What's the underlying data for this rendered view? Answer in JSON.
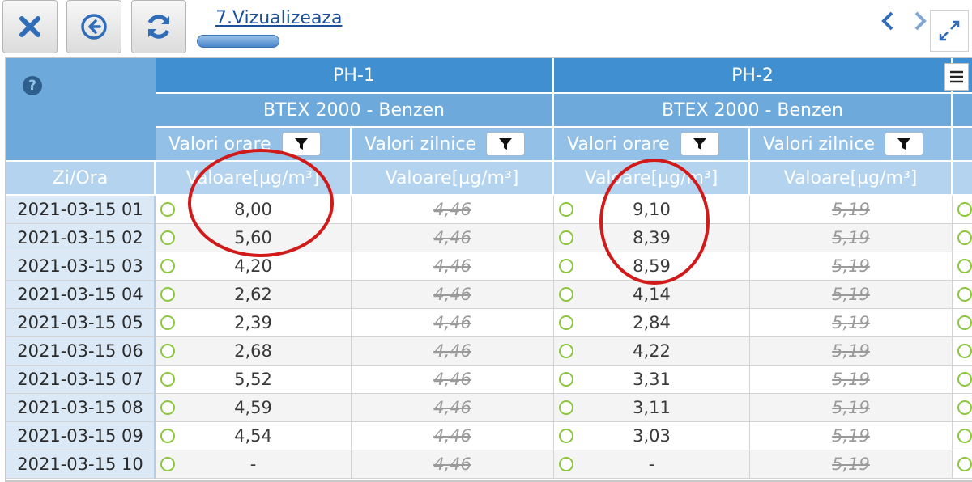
{
  "toolbar": {
    "tab_label": "7.Vizualizeaza",
    "icons": {
      "close": "close-icon",
      "back": "back-circle-icon",
      "refresh": "refresh-icon",
      "prev": "chevron-left-icon",
      "next": "chevron-right-icon",
      "expand": "expand-icon"
    }
  },
  "grid": {
    "corner_header": "Zi/Ora",
    "stations": [
      {
        "name": "PH-1",
        "pollutant": "BTEX 2000 - Benzen"
      },
      {
        "name": "PH-2",
        "pollutant": "BTEX 2000 - Benzen"
      }
    ],
    "subheaders": {
      "hourly": "Valori orare",
      "daily": "Valori zilnice"
    },
    "unit_header": "Valoare[µg/m³]",
    "rows": [
      {
        "date": "2021-03-15 01",
        "ph1_hourly": "8,00",
        "ph1_daily": "4,46",
        "ph2_hourly": "9,10",
        "ph2_daily": "5,19"
      },
      {
        "date": "2021-03-15 02",
        "ph1_hourly": "5,60",
        "ph1_daily": "4,46",
        "ph2_hourly": "8,39",
        "ph2_daily": "5,19"
      },
      {
        "date": "2021-03-15 03",
        "ph1_hourly": "4,20",
        "ph1_daily": "4,46",
        "ph2_hourly": "8,59",
        "ph2_daily": "5,19"
      },
      {
        "date": "2021-03-15 04",
        "ph1_hourly": "2,62",
        "ph1_daily": "4,46",
        "ph2_hourly": "4,14",
        "ph2_daily": "5,19"
      },
      {
        "date": "2021-03-15 05",
        "ph1_hourly": "2,39",
        "ph1_daily": "4,46",
        "ph2_hourly": "2,84",
        "ph2_daily": "5,19"
      },
      {
        "date": "2021-03-15 06",
        "ph1_hourly": "2,68",
        "ph1_daily": "4,46",
        "ph2_hourly": "4,22",
        "ph2_daily": "5,19"
      },
      {
        "date": "2021-03-15 07",
        "ph1_hourly": "5,52",
        "ph1_daily": "4,46",
        "ph2_hourly": "3,31",
        "ph2_daily": "5,19"
      },
      {
        "date": "2021-03-15 08",
        "ph1_hourly": "4,59",
        "ph1_daily": "4,46",
        "ph2_hourly": "3,11",
        "ph2_daily": "5,19"
      },
      {
        "date": "2021-03-15 09",
        "ph1_hourly": "4,54",
        "ph1_daily": "4,46",
        "ph2_hourly": "3,03",
        "ph2_daily": "5,19"
      },
      {
        "date": "2021-03-15 10",
        "ph1_hourly": "-",
        "ph1_daily": "4,46",
        "ph2_hourly": "-",
        "ph2_daily": "5,19"
      }
    ]
  },
  "colors": {
    "header_dark": "#3f8fd1",
    "status_ok": "#8cc63f",
    "annotation": "#d11a1a"
  }
}
